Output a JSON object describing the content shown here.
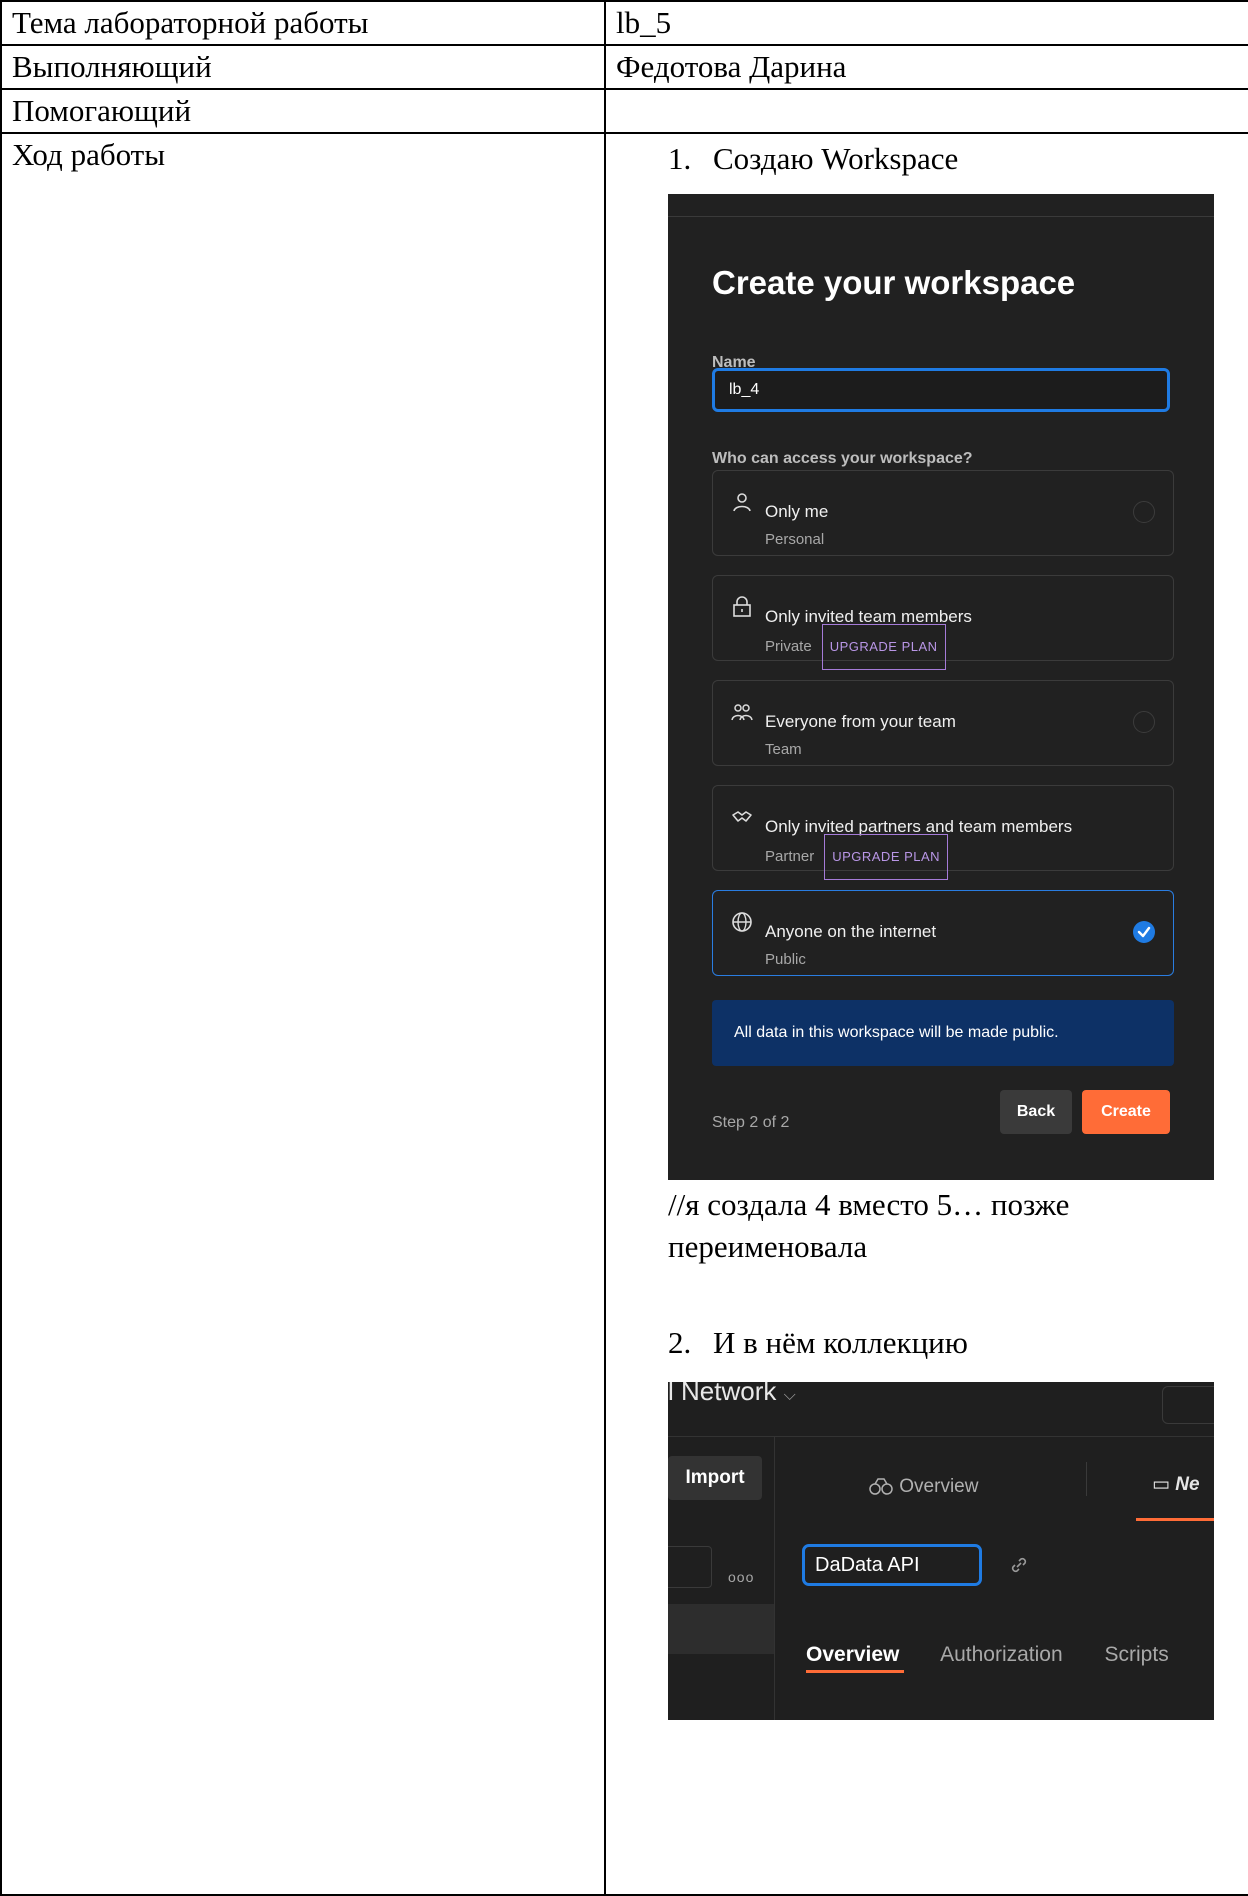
{
  "rows": [
    {
      "label": "Тема лабораторной работы",
      "value": "lb_5"
    },
    {
      "label": "Выполняющий",
      "value": "Федотова Дарина"
    },
    {
      "label": "Помогающий",
      "value": ""
    },
    {
      "label": "Ход работы"
    }
  ],
  "steps": [
    {
      "num": "1.",
      "title": "Создаю Workspace"
    },
    {
      "num": "2.",
      "title": "И в нём коллекцию"
    }
  ],
  "note": "//я создала 4 вместо 5… позже переименовала",
  "workspace_dialog": {
    "heading": "Create your workspace",
    "name_label": "Name",
    "name_value": "lb_4",
    "access_label": "Who can access your workspace?",
    "options": [
      {
        "title": "Only me",
        "subtitle": "Personal",
        "badge": "",
        "icon": "person-icon",
        "selected": false
      },
      {
        "title": "Only invited team members",
        "subtitle": "Private",
        "badge": "UPGRADE PLAN",
        "icon": "lock-icon",
        "selected": false
      },
      {
        "title": "Everyone from your team",
        "subtitle": "Team",
        "badge": "",
        "icon": "team-icon",
        "selected": false
      },
      {
        "title": "Only invited partners and team members",
        "subtitle": "Partner",
        "badge": "UPGRADE PLAN",
        "icon": "handshake-icon",
        "selected": false
      },
      {
        "title": "Anyone on the internet",
        "subtitle": "Public",
        "badge": "",
        "icon": "globe-icon",
        "selected": true
      }
    ],
    "notice": "All data in this workspace will be made public.",
    "step_text": "Step 2 of 2",
    "back_label": "Back",
    "create_label": "Create",
    "colors": {
      "background": "#212121",
      "accent": "#1f7be3",
      "create": "#ff6c37",
      "notice": "#0d3166",
      "badge": "#a57bd8"
    }
  },
  "collection_view": {
    "workspace_fragment": "l Network",
    "import_label": "Import",
    "overview_tab": "Overview",
    "new_tab": "Ne",
    "collection_name": "DaData API",
    "tabs": [
      "Overview",
      "Authorization",
      "Scripts"
    ],
    "dots": "ooo"
  }
}
